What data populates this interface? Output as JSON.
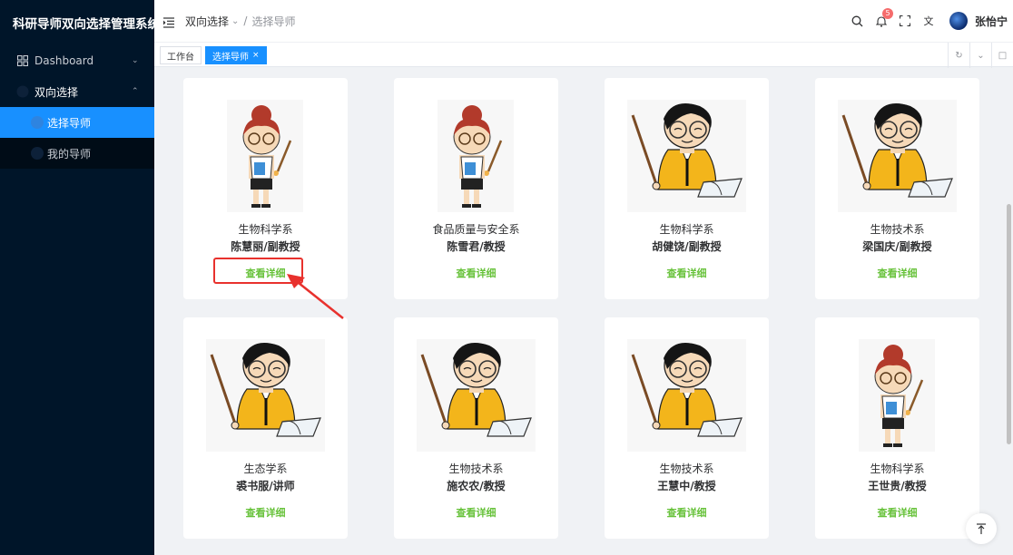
{
  "app": {
    "title": "科研导师双向选择管理系统"
  },
  "sidebar": {
    "items": [
      {
        "label": "Dashboard",
        "icon": "grid-icon"
      },
      {
        "label": "双向选择",
        "icon": "circle-icon"
      }
    ],
    "subitems": [
      {
        "label": "选择导师",
        "active": true
      },
      {
        "label": "我的导师",
        "active": false
      }
    ]
  },
  "header": {
    "breadcrumb": {
      "parent": "双向选择",
      "current": "选择导师"
    },
    "notification_count": "5",
    "username": "张怡宁"
  },
  "tabs": [
    {
      "label": "工作台"
    },
    {
      "label": "选择导师",
      "close": "×"
    }
  ],
  "cards": [
    {
      "dept": "生物科学系",
      "name": "陈慧丽/副教授",
      "detail": "查看详细",
      "avatar": "female-teacher"
    },
    {
      "dept": "食品质量与安全系",
      "name": "陈雪君/教授",
      "detail": "查看详细",
      "avatar": "female-teacher"
    },
    {
      "dept": "生物科学系",
      "name": "胡健饶/副教授",
      "detail": "查看详细",
      "avatar": "male-teacher"
    },
    {
      "dept": "生物技术系",
      "name": "梁国庆/副教授",
      "detail": "查看详细",
      "avatar": "male-teacher"
    },
    {
      "dept": "生态学系",
      "name": "裘书服/讲师",
      "detail": "查看详细",
      "avatar": "male-teacher"
    },
    {
      "dept": "生物技术系",
      "name": "施农农/教授",
      "detail": "查看详细",
      "avatar": "male-teacher"
    },
    {
      "dept": "生物技术系",
      "name": "王慧中/教授",
      "detail": "查看详细",
      "avatar": "male-teacher"
    },
    {
      "dept": "生物科学系",
      "name": "王世贵/教授",
      "detail": "查看详细",
      "avatar": "female-teacher"
    }
  ],
  "colors": {
    "sidebar": "#001529",
    "active": "#1890ff",
    "link": "#67c23a",
    "annotation": "#e8312d"
  }
}
